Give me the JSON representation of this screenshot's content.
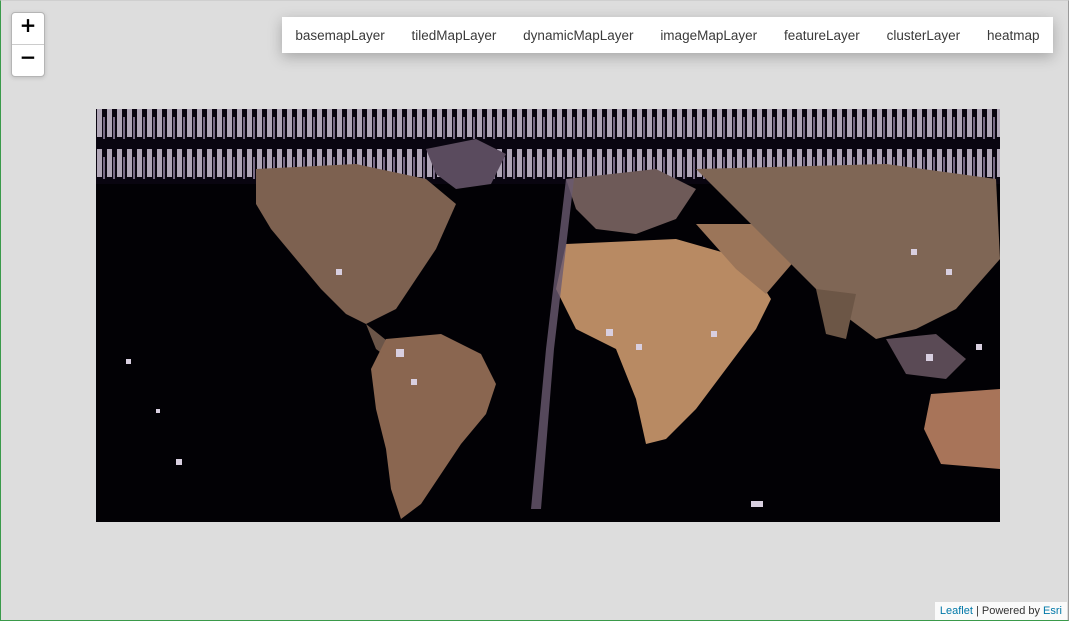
{
  "zoom": {
    "in_label": "+",
    "out_label": "−"
  },
  "layers": [
    {
      "label": "basemapLayer"
    },
    {
      "label": "tiledMapLayer"
    },
    {
      "label": "dynamicMapLayer"
    },
    {
      "label": "imageMapLayer"
    },
    {
      "label": "featureLayer"
    },
    {
      "label": "clusterLayer"
    },
    {
      "label": "heatmap"
    }
  ],
  "attribution": {
    "leaflet_label": "Leaflet",
    "separator": " | Powered by ",
    "esri_label": "Esri"
  },
  "map_image": {
    "content": "satellite imagery world-map-icon",
    "background": "#020105"
  },
  "colors": {
    "map_background": "#dddddd",
    "link": "#0078a8"
  }
}
